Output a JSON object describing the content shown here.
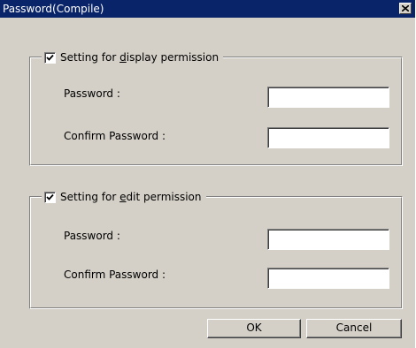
{
  "window": {
    "title": "Password(Compile)",
    "close_icon": "close-icon"
  },
  "display_group": {
    "checked": true,
    "label_pre": "Setting for ",
    "label_accel": "d",
    "label_post": "isplay permission",
    "password_label": "Password :",
    "confirm_label": "Confirm Password :",
    "password_value": "",
    "confirm_value": ""
  },
  "edit_group": {
    "checked": true,
    "label_pre": "Setting for ",
    "label_accel": "e",
    "label_post": "dit permission",
    "password_label": "Password :",
    "confirm_label": "Confirm Password :",
    "password_value": "",
    "confirm_value": ""
  },
  "buttons": {
    "ok": "OK",
    "cancel": "Cancel"
  }
}
